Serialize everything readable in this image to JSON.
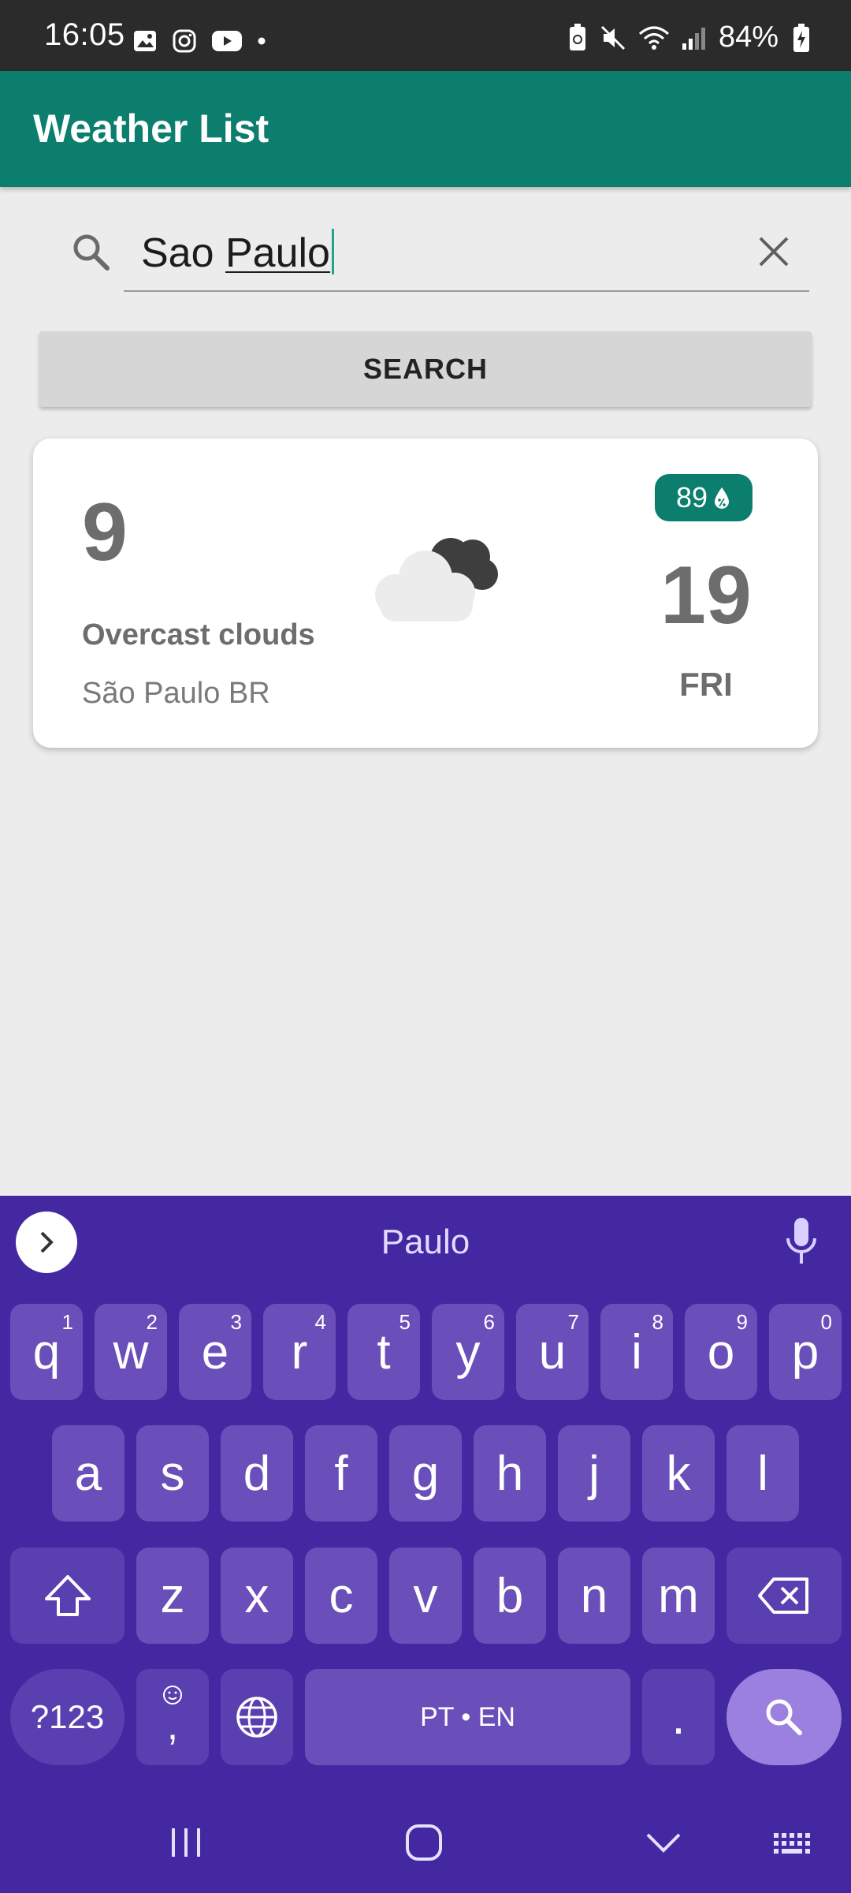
{
  "status_bar": {
    "time": "16:05",
    "battery": "84%"
  },
  "app_bar": {
    "title": "Weather List"
  },
  "search": {
    "value_part1": "Sao ",
    "value_part2": "Paulo",
    "button_label": "SEARCH"
  },
  "weather_card": {
    "temperature": "9",
    "description": "Overcast clouds",
    "city": "São Paulo BR",
    "humidity": "89",
    "day_number": "19",
    "day_name": "FRI",
    "icon": "overcast-cloud-icon"
  },
  "keyboard": {
    "suggestion": "Paulo",
    "row1": [
      {
        "label": "q",
        "hint": "1"
      },
      {
        "label": "w",
        "hint": "2"
      },
      {
        "label": "e",
        "hint": "3"
      },
      {
        "label": "r",
        "hint": "4"
      },
      {
        "label": "t",
        "hint": "5"
      },
      {
        "label": "y",
        "hint": "6"
      },
      {
        "label": "u",
        "hint": "7"
      },
      {
        "label": "i",
        "hint": "8"
      },
      {
        "label": "o",
        "hint": "9"
      },
      {
        "label": "p",
        "hint": "0"
      }
    ],
    "row2": [
      "a",
      "s",
      "d",
      "f",
      "g",
      "h",
      "j",
      "k",
      "l"
    ],
    "row3": [
      "z",
      "x",
      "c",
      "v",
      "b",
      "n",
      "m"
    ],
    "symbols_label": "?123",
    "comma_label": ",",
    "space_label": "PT • EN",
    "period_label": "."
  },
  "colors": {
    "primary": "#0b7e6e",
    "keyboard_bg": "#4328a2",
    "key_bg": "#6a4fba"
  }
}
